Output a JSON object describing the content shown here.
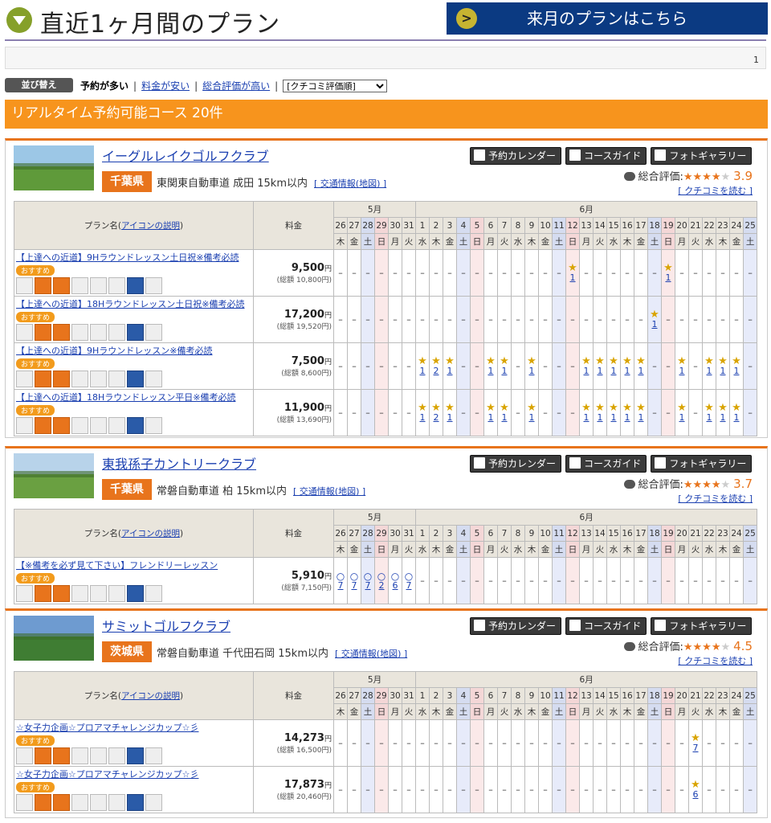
{
  "header": {
    "title": "直近1ヶ月間のプラン",
    "next_month_button": "来月のプランはこちら"
  },
  "pager": {
    "page": "1"
  },
  "sort": {
    "label": "並び替え",
    "options": [
      {
        "label": "予約が多い",
        "active": true
      },
      {
        "label": "料金が安い",
        "active": false
      },
      {
        "label": "総合評価が高い",
        "active": false
      }
    ],
    "select_value": "[クチコミ評価順]"
  },
  "banner": {
    "text": "リアルタイム予約可能コース 20件"
  },
  "common": {
    "btn_calendar": "予約カレンダー",
    "btn_guide": "コースガイド",
    "btn_gallery": "フォトギャラリー",
    "rating_label": "総合評価:",
    "read_reviews": "[ クチコミを読む ]",
    "traffic_info": "[ 交通情報(地図) ]",
    "plan_name_header_prefix": "プラン名(",
    "plan_name_header_link": "アイコンの説明",
    "plan_name_header_suffix": ")",
    "price_header": "料金",
    "total_label": "(総額",
    "recommend": "おすすめ",
    "unavailable": "–",
    "yen": "円",
    "month_may": "5月",
    "month_jun": "6月"
  },
  "dates": [
    {
      "d": "26",
      "w": "木",
      "t": ""
    },
    {
      "d": "27",
      "w": "金",
      "t": ""
    },
    {
      "d": "28",
      "w": "土",
      "t": "sat"
    },
    {
      "d": "29",
      "w": "日",
      "t": "sun"
    },
    {
      "d": "30",
      "w": "月",
      "t": ""
    },
    {
      "d": "31",
      "w": "火",
      "t": ""
    },
    {
      "d": "1",
      "w": "水",
      "t": ""
    },
    {
      "d": "2",
      "w": "木",
      "t": ""
    },
    {
      "d": "3",
      "w": "金",
      "t": ""
    },
    {
      "d": "4",
      "w": "土",
      "t": "sat"
    },
    {
      "d": "5",
      "w": "日",
      "t": "sun"
    },
    {
      "d": "6",
      "w": "月",
      "t": ""
    },
    {
      "d": "7",
      "w": "火",
      "t": ""
    },
    {
      "d": "8",
      "w": "水",
      "t": ""
    },
    {
      "d": "9",
      "w": "木",
      "t": ""
    },
    {
      "d": "10",
      "w": "金",
      "t": ""
    },
    {
      "d": "11",
      "w": "土",
      "t": "sat"
    },
    {
      "d": "12",
      "w": "日",
      "t": "sun"
    },
    {
      "d": "13",
      "w": "月",
      "t": ""
    },
    {
      "d": "14",
      "w": "火",
      "t": ""
    },
    {
      "d": "15",
      "w": "水",
      "t": ""
    },
    {
      "d": "16",
      "w": "木",
      "t": ""
    },
    {
      "d": "17",
      "w": "金",
      "t": ""
    },
    {
      "d": "18",
      "w": "土",
      "t": "sat"
    },
    {
      "d": "19",
      "w": "日",
      "t": "sun"
    },
    {
      "d": "20",
      "w": "月",
      "t": ""
    },
    {
      "d": "21",
      "w": "火",
      "t": ""
    },
    {
      "d": "22",
      "w": "水",
      "t": ""
    },
    {
      "d": "23",
      "w": "木",
      "t": ""
    },
    {
      "d": "24",
      "w": "金",
      "t": ""
    },
    {
      "d": "25",
      "w": "土",
      "t": "sat"
    }
  ],
  "courses": [
    {
      "name": "イーグルレイクゴルフクラブ",
      "pref": "千葉県",
      "road": "東関東自動車道 成田 15km以内",
      "stars": "★★★★",
      "stars_off": "★",
      "score": "3.9",
      "photo_sky": "#9cc7e6",
      "photo_ground": "#5f9a3a",
      "plans": [
        {
          "name": "【上達への近道】9Hラウンドレッスン土日祝※備考必読",
          "price": "9,500",
          "total": "10,800円)",
          "slots": {
            "17": "1",
            "24": "1"
          }
        },
        {
          "name": "【上達への近道】18Hラウンドレッスン土日祝※備考必読",
          "price": "17,200",
          "total": "19,520円)",
          "slots": {
            "23": "1"
          }
        },
        {
          "name": "【上達への近道】9Hラウンドレッスン※備考必読",
          "price": "7,500",
          "total": "8,600円)",
          "slots": {
            "6": "1",
            "7": "2",
            "8": "1",
            "11": "1",
            "12": "1",
            "14": "1",
            "18": "1",
            "19": "1",
            "20": "1",
            "21": "1",
            "22": "1",
            "25": "1",
            "27": "1",
            "28": "1",
            "29": "1"
          }
        },
        {
          "name": "【上達への近道】18Hラウンドレッスン平日※備考必読",
          "price": "11,900",
          "total": "13,690円)",
          "slots": {
            "6": "1",
            "7": "2",
            "8": "1",
            "11": "1",
            "12": "1",
            "14": "1",
            "18": "1",
            "19": "1",
            "20": "1",
            "21": "1",
            "22": "1",
            "25": "1",
            "27": "1",
            "28": "1",
            "29": "1"
          }
        }
      ]
    },
    {
      "name": "東我孫子カントリークラブ",
      "pref": "千葉県",
      "road": "常磐自動車道 柏 15km以内",
      "stars": "★★★★",
      "stars_off": "★",
      "score": "3.7",
      "photo_sky": "#b8d3ea",
      "photo_ground": "#6aa041",
      "plans": [
        {
          "name": "【※備考を必ず見て下さい】フレンドリーレッスン",
          "price": "5,910",
          "total": "7,150円)",
          "circles": {
            "0": "7",
            "1": "7",
            "2": "7",
            "3": "2",
            "4": "6",
            "5": "7"
          }
        }
      ]
    },
    {
      "name": "サミットゴルフクラブ",
      "pref": "茨城県",
      "road": "常磐自動車道 千代田石岡 15km以内",
      "stars": "★★★★",
      "stars_off": "★",
      "score": "4.5",
      "photo_sky": "#6e9bd0",
      "photo_ground": "#3f7d33",
      "plans": [
        {
          "name": "☆女子力企画☆プロアマチャレンジカップ☆彡",
          "price": "14,273",
          "total": "16,500円)",
          "slots": {
            "26": "7"
          }
        },
        {
          "name": "☆女子力企画☆プロアマチャレンジカップ☆彡",
          "price": "17,873",
          "total": "20,460円)",
          "slots": {
            "26": "6"
          }
        }
      ]
    }
  ]
}
